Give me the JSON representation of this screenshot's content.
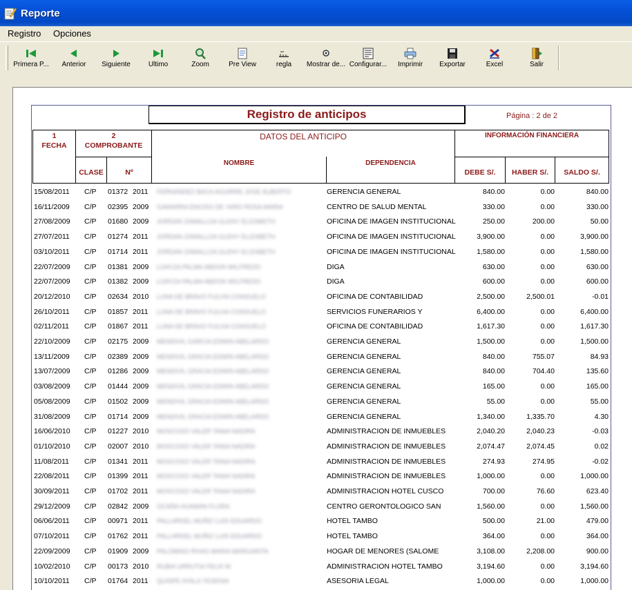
{
  "window": {
    "title": "Reporte"
  },
  "menu": {
    "items": [
      "Registro",
      "Opciones"
    ]
  },
  "toolbar": {
    "buttons": [
      {
        "label": "Primera P...",
        "icon": "first-page-icon"
      },
      {
        "label": "Anterior",
        "icon": "previous-icon"
      },
      {
        "label": "Siguiente",
        "icon": "next-icon"
      },
      {
        "label": "Ultimo",
        "icon": "last-page-icon"
      },
      {
        "label": "Zoom",
        "icon": "zoom-icon"
      },
      {
        "label": "Pre View",
        "icon": "preview-icon"
      },
      {
        "label": "regla",
        "icon": "ruler-icon"
      },
      {
        "label": "Mostrar de...",
        "icon": "show-icon"
      },
      {
        "label": "Configurar...",
        "icon": "configure-icon"
      },
      {
        "label": "Imprimir",
        "icon": "printer-icon"
      },
      {
        "label": "Exportar",
        "icon": "floppy-disk-icon"
      },
      {
        "label": "Excel",
        "icon": "excel-icon"
      },
      {
        "label": "Salir",
        "icon": "exit-door-icon"
      }
    ]
  },
  "report": {
    "title": "Registro de anticipos",
    "page": "Página : 2 de 2",
    "headers": {
      "col1_num": "1",
      "fecha": "FECHA",
      "col2_num": "2",
      "comprobante": "COMPROBANTE",
      "datos": "DATOS DEL ANTICIPO",
      "info": "INFORMACIÓN FINANCIERA",
      "clase": "CLASE",
      "numero": "Nº",
      "nombre": "NOMBRE",
      "dependencia": "DEPENDENCIA",
      "debe": "DEBE S/.",
      "haber": "HABER S/.",
      "saldo": "SALDO S/."
    },
    "rows": [
      {
        "fecha": "15/08/2011",
        "clase": "C/P",
        "num": "01372",
        "anio": "2011",
        "nombre": "FERNANDEZ BACA AGUIRRE JOSE ALBERTO",
        "dep": "GERENCIA GENERAL",
        "debe": "840.00",
        "haber": "0.00",
        "saldo": "840.00"
      },
      {
        "fecha": "16/11/2009",
        "clase": "C/P",
        "num": "02395",
        "anio": "2009",
        "nombre": "GAMARRA ENCISO DE YARO ROSA MARIA",
        "dep": "CENTRO DE SALUD MENTAL",
        "debe": "330.00",
        "haber": "0.00",
        "saldo": "330.00"
      },
      {
        "fecha": "27/08/2009",
        "clase": "C/P",
        "num": "01680",
        "anio": "2009",
        "nombre": "JORDAN ZAMALLOA GLENY ELIZABETH",
        "dep": "OFICINA DE IMAGEN INSTITUCIONAL",
        "debe": "250.00",
        "haber": "200.00",
        "saldo": "50.00"
      },
      {
        "fecha": "27/07/2011",
        "clase": "C/P",
        "num": "01274",
        "anio": "2011",
        "nombre": "JORDAN ZAMALLOA GLENY ELIZABETH",
        "dep": "OFICINA DE IMAGEN INSTITUCIONAL",
        "debe": "3,900.00",
        "haber": "0.00",
        "saldo": "3,900.00"
      },
      {
        "fecha": "03/10/2011",
        "clase": "C/P",
        "num": "01714",
        "anio": "2011",
        "nombre": "JORDAN ZAMALLOA GLENY ELIZABETH",
        "dep": "OFICINA DE IMAGEN INSTITUCIONAL",
        "debe": "1,580.00",
        "haber": "0.00",
        "saldo": "1,580.00"
      },
      {
        "fecha": "22/07/2009",
        "clase": "C/P",
        "num": "01381",
        "anio": "2009",
        "nombre": "LOAYZA PALMA ABDON WILFREDO",
        "dep": "DIGA",
        "debe": "630.00",
        "haber": "0.00",
        "saldo": "630.00"
      },
      {
        "fecha": "22/07/2009",
        "clase": "C/P",
        "num": "01382",
        "anio": "2009",
        "nombre": "LOAYZA PALMA ABDON WILFREDO",
        "dep": "DIGA",
        "debe": "600.00",
        "haber": "0.00",
        "saldo": "600.00"
      },
      {
        "fecha": "20/12/2010",
        "clase": "C/P",
        "num": "02634",
        "anio": "2010",
        "nombre": "LUNA DE BRAVO FULVIA CONSUELO",
        "dep": "OFICINA DE CONTABILIDAD",
        "debe": "2,500.00",
        "haber": "2,500.01",
        "saldo": "-0.01"
      },
      {
        "fecha": "26/10/2011",
        "clase": "C/P",
        "num": "01857",
        "anio": "2011",
        "nombre": "LUNA DE BRAVO FULVIA CONSUELO",
        "dep": "SERVICIOS FUNERARIOS Y",
        "debe": "6,400.00",
        "haber": "0.00",
        "saldo": "6,400.00"
      },
      {
        "fecha": "02/11/2011",
        "clase": "C/P",
        "num": "01867",
        "anio": "2011",
        "nombre": "LUNA DE BRAVO FULVIA CONSUELO",
        "dep": "OFICINA DE CONTABILIDAD",
        "debe": "1,617.30",
        "haber": "0.00",
        "saldo": "1,617.30"
      },
      {
        "fecha": "22/10/2009",
        "clase": "C/P",
        "num": "02175",
        "anio": "2009",
        "nombre": "MENDIVIL GARCIA EDWIN ABELARDO",
        "dep": "GERENCIA GENERAL",
        "debe": "1,500.00",
        "haber": "0.00",
        "saldo": "1,500.00"
      },
      {
        "fecha": "13/11/2009",
        "clase": "C/P",
        "num": "02389",
        "anio": "2009",
        "nombre": "MENDIVIL GRACIA EDWIN ABELARDO",
        "dep": "GERENCIA GENERAL",
        "debe": "840.00",
        "haber": "755.07",
        "saldo": "84.93"
      },
      {
        "fecha": "13/07/2009",
        "clase": "C/P",
        "num": "01286",
        "anio": "2009",
        "nombre": "MENDIVIL GRACIA EDWIN ABELARDO",
        "dep": "GERENCIA GENERAL",
        "debe": "840.00",
        "haber": "704.40",
        "saldo": "135.60"
      },
      {
        "fecha": "03/08/2009",
        "clase": "C/P",
        "num": "01444",
        "anio": "2009",
        "nombre": "MENDIVIL GRACIA EDWIN ABELARDO",
        "dep": "GERENCIA GENERAL",
        "debe": "165.00",
        "haber": "0.00",
        "saldo": "165.00"
      },
      {
        "fecha": "05/08/2009",
        "clase": "C/P",
        "num": "01502",
        "anio": "2009",
        "nombre": "MENDIVIL GRACIA EDWIN ABELARDO",
        "dep": "GERENCIA GENERAL",
        "debe": "55.00",
        "haber": "0.00",
        "saldo": "55.00"
      },
      {
        "fecha": "31/08/2009",
        "clase": "C/P",
        "num": "01714",
        "anio": "2009",
        "nombre": "MENDIVIL GRACIA EDWIN ABELARDO",
        "dep": "GERENCIA GENERAL",
        "debe": "1,340.00",
        "haber": "1,335.70",
        "saldo": "4.30"
      },
      {
        "fecha": "16/06/2010",
        "clase": "C/P",
        "num": "01227",
        "anio": "2010",
        "nombre": "MOSCOSO VALER TANIA NADIRA",
        "dep": "ADMINISTRACION DE INMUEBLES",
        "debe": "2,040.20",
        "haber": "2,040.23",
        "saldo": "-0.03"
      },
      {
        "fecha": "01/10/2010",
        "clase": "C/P",
        "num": "02007",
        "anio": "2010",
        "nombre": "MOSCOSO VALER TANIA NADIRA",
        "dep": "ADMINISTRACION DE INMUEBLES",
        "debe": "2,074.47",
        "haber": "2,074.45",
        "saldo": "0.02"
      },
      {
        "fecha": "11/08/2011",
        "clase": "C/P",
        "num": "01341",
        "anio": "2011",
        "nombre": "MOSCOSO VALER TANIA NADIRA",
        "dep": "ADMINISTRACION DE INMUEBLES",
        "debe": "274.93",
        "haber": "274.95",
        "saldo": "-0.02"
      },
      {
        "fecha": "22/08/2011",
        "clase": "C/P",
        "num": "01399",
        "anio": "2011",
        "nombre": "MOSCOSO VALER TANIA NADIRA",
        "dep": "ADMINISTRACION DE INMUEBLES",
        "debe": "1,000.00",
        "haber": "0.00",
        "saldo": "1,000.00"
      },
      {
        "fecha": "30/09/2011",
        "clase": "C/P",
        "num": "01702",
        "anio": "2011",
        "nombre": "MOSCOSO VALER TANIA NADIRA",
        "dep": "ADMINISTRACION HOTEL CUSCO",
        "debe": "700.00",
        "haber": "76.60",
        "saldo": "623.40"
      },
      {
        "fecha": "29/12/2009",
        "clase": "C/P",
        "num": "02842",
        "anio": "2009",
        "nombre": "OCAÑA HUAMAN FLORA",
        "dep": "CENTRO GERONTOLOGICO SAN",
        "debe": "1,560.00",
        "haber": "0.00",
        "saldo": "1,560.00"
      },
      {
        "fecha": "06/06/2011",
        "clase": "C/P",
        "num": "00971",
        "anio": "2011",
        "nombre": "PALLARDEL MUÑIZ LUIS EDUARDO",
        "dep": "HOTEL TAMBO",
        "debe": "500.00",
        "haber": "21.00",
        "saldo": "479.00"
      },
      {
        "fecha": "07/10/2011",
        "clase": "C/P",
        "num": "01762",
        "anio": "2011",
        "nombre": "PALLARDEL MUÑIZ LUIS EDUARDO",
        "dep": "HOTEL TAMBO",
        "debe": "364.00",
        "haber": "0.00",
        "saldo": "364.00"
      },
      {
        "fecha": "22/09/2009",
        "clase": "C/P",
        "num": "01909",
        "anio": "2009",
        "nombre": "PALOMINO RIVAS MARIA MARGARITA",
        "dep": "HOGAR DE MENORES (SALOME",
        "debe": "3,108.00",
        "haber": "2,208.00",
        "saldo": "900.00"
      },
      {
        "fecha": "10/02/2010",
        "clase": "C/P",
        "num": "00173",
        "anio": "2010",
        "nombre": "RUBIA URRUTIA FELIX M.",
        "dep": "ADMINISTRACION HOTEL TAMBO",
        "debe": "3,194.60",
        "haber": "0.00",
        "saldo": "3,194.60"
      },
      {
        "fecha": "10/10/2011",
        "clase": "C/P",
        "num": "01764",
        "anio": "2011",
        "nombre": "QUISPE AYALA YESENIA",
        "dep": "ASESORIA LEGAL",
        "debe": "1,000.00",
        "haber": "0.00",
        "saldo": "1,000.00"
      }
    ]
  }
}
